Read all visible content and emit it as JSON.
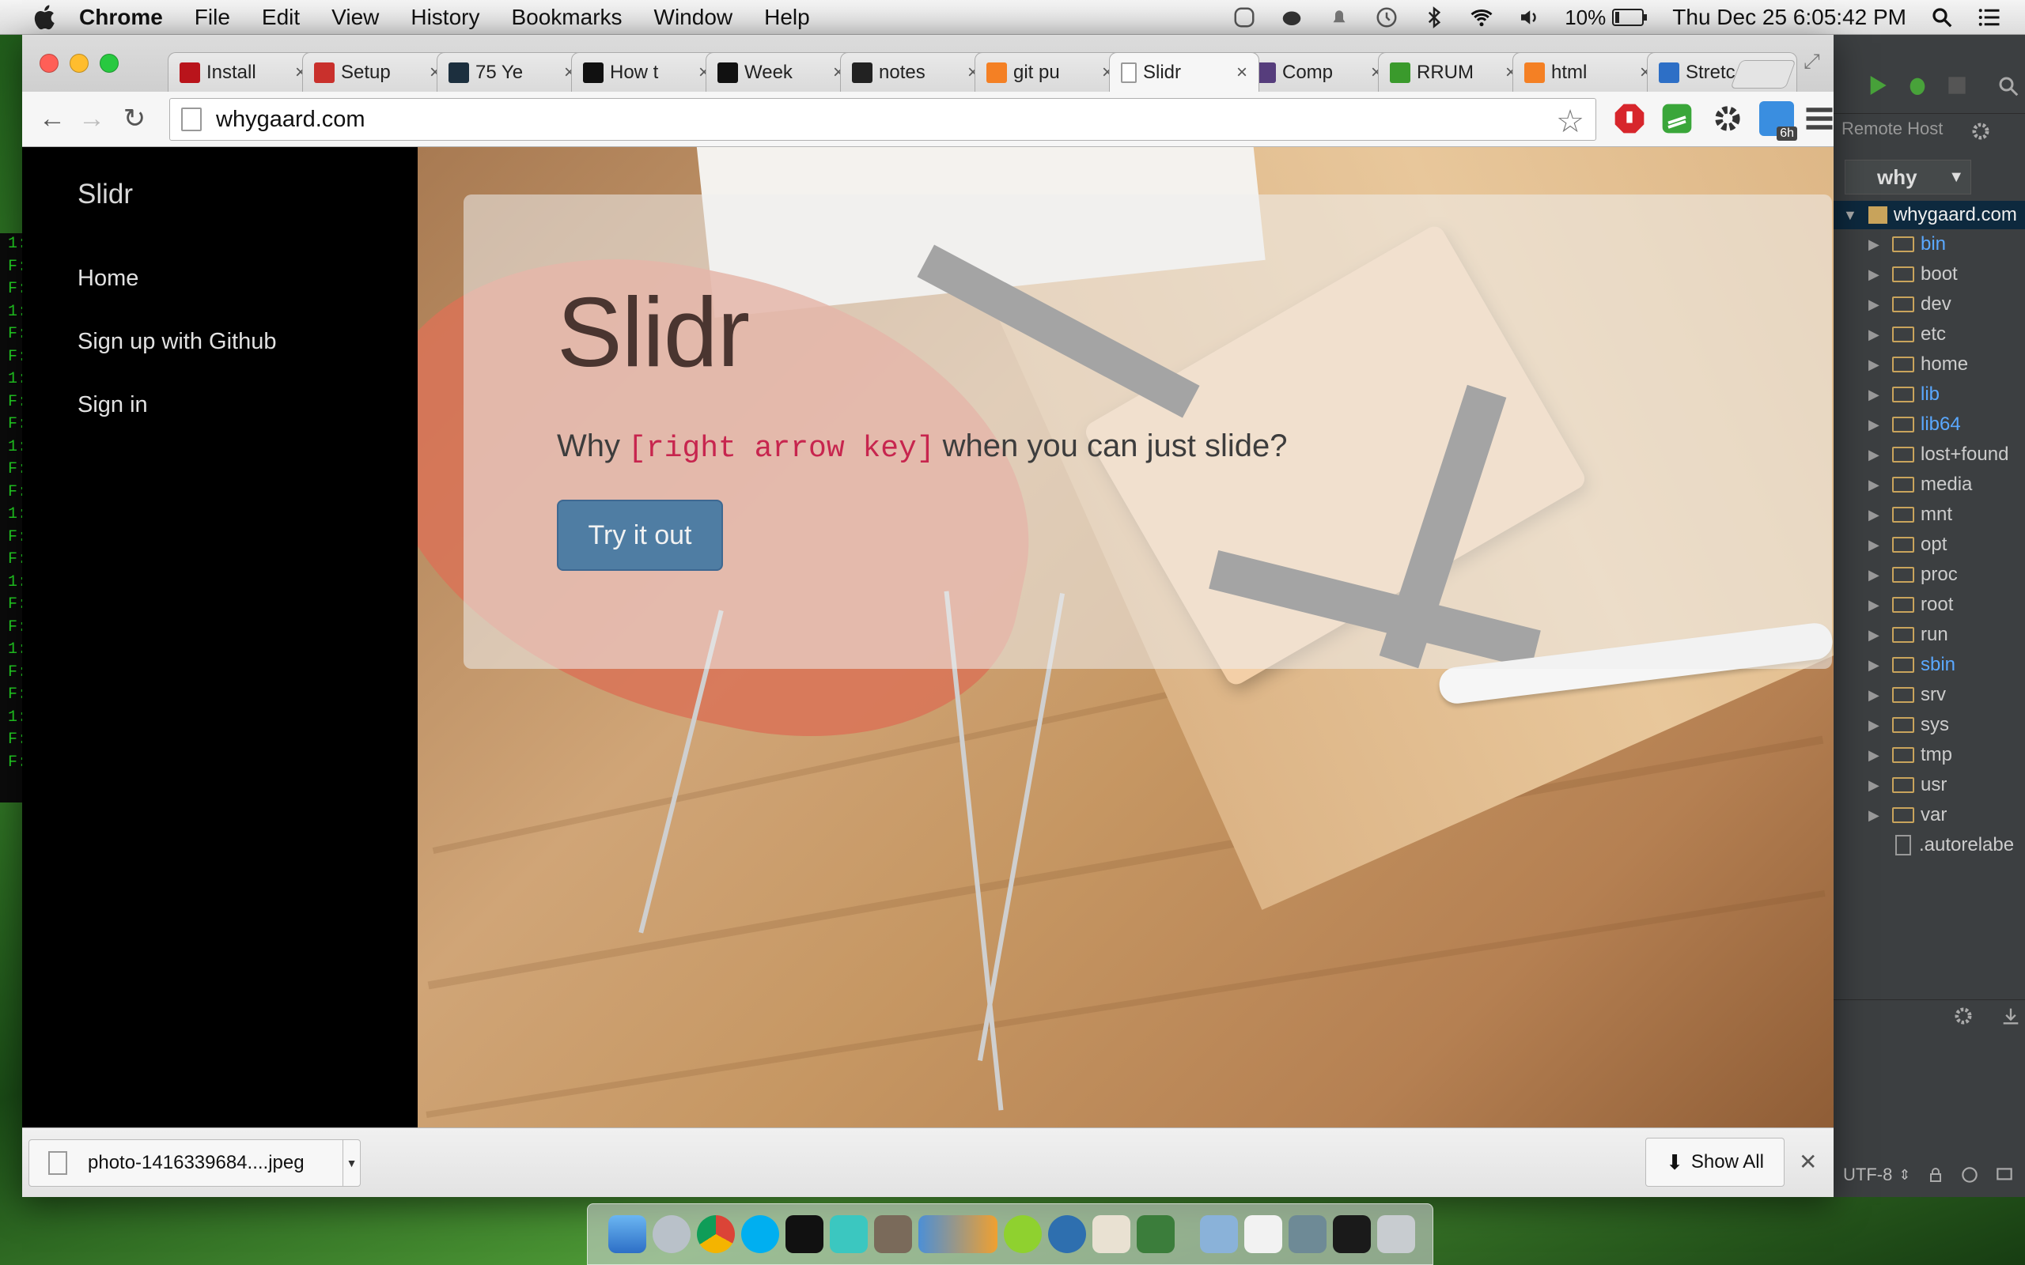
{
  "menubar": {
    "app_name": "Chrome",
    "items": [
      "File",
      "Edit",
      "View",
      "History",
      "Bookmarks",
      "Window",
      "Help"
    ],
    "battery": "10%",
    "datetime": "Thu Dec 25  6:05:42 PM"
  },
  "browser": {
    "tabs": [
      {
        "title": "Install",
        "favicon": "ruby-icon",
        "color": "#b9141b"
      },
      {
        "title": "Setup",
        "favicon": "red-mountain-icon",
        "color": "#c9302c"
      },
      {
        "title": "75 Ye",
        "favicon": "ft-icon",
        "color": "#1c2f3e"
      },
      {
        "title": "How t",
        "favicon": "b-icon",
        "color": "#111111"
      },
      {
        "title": "Week",
        "favicon": "medium-icon",
        "color": "#111111"
      },
      {
        "title": "notes",
        "favicon": "github-icon",
        "color": "#222222"
      },
      {
        "title": "git pu",
        "favicon": "stackoverflow-icon",
        "color": "#f48024"
      },
      {
        "title": "Slidr",
        "favicon": "page-icon",
        "color": "#ffffff",
        "active": true
      },
      {
        "title": "Comp",
        "favicon": "bootstrap-icon",
        "color": "#563d7c"
      },
      {
        "title": "RRUM",
        "favicon": "green-circle-icon",
        "color": "#3a9a2c"
      },
      {
        "title": "html",
        "favicon": "stackoverflow-icon",
        "color": "#f48024"
      },
      {
        "title": "Stretc",
        "favicon": "swoosh-icon",
        "color": "#2d6fc6"
      }
    ],
    "url": "whygaard.com",
    "ext_badge": "6h"
  },
  "page": {
    "brand": "Slidr",
    "nav": [
      "Home",
      "Sign up with Github",
      "Sign in"
    ],
    "hero_title": "Slidr",
    "lead_before": "Why",
    "lead_code": "[right arrow key]",
    "lead_after": "when you can just slide?",
    "cta": "Try it out"
  },
  "download_shelf": {
    "filename": "photo-1416339684....jpeg",
    "show_all": "Show All"
  },
  "ide": {
    "remote_host_label": "Remote Host",
    "project_combo": "why",
    "root": "whygaard.com",
    "folders": [
      {
        "name": "bin",
        "link": true
      },
      {
        "name": "boot",
        "link": false
      },
      {
        "name": "dev",
        "link": false
      },
      {
        "name": "etc",
        "link": false
      },
      {
        "name": "home",
        "link": false
      },
      {
        "name": "lib",
        "link": true
      },
      {
        "name": "lib64",
        "link": true
      },
      {
        "name": "lost+found",
        "link": false
      },
      {
        "name": "media",
        "link": false
      },
      {
        "name": "mnt",
        "link": false
      },
      {
        "name": "opt",
        "link": false
      },
      {
        "name": "proc",
        "link": false
      },
      {
        "name": "root",
        "link": false
      },
      {
        "name": "run",
        "link": false
      },
      {
        "name": "sbin",
        "link": true
      },
      {
        "name": "srv",
        "link": false
      },
      {
        "name": "sys",
        "link": false
      },
      {
        "name": "tmp",
        "link": false
      },
      {
        "name": "usr",
        "link": false
      },
      {
        "name": "var",
        "link": false
      }
    ],
    "file": ".autorelabe",
    "encoding": "UTF-8"
  },
  "terminal_lines": [
    "1:",
    "F:",
    "F:",
    "1:",
    "F:",
    "F:",
    "1:",
    "F:",
    "F:",
    "1:",
    "F:",
    "F:",
    "1:",
    "F:",
    "F:",
    "1:",
    "F:",
    "F:",
    "1:",
    "F:",
    "F:",
    "1:",
    "F:",
    "F:"
  ]
}
